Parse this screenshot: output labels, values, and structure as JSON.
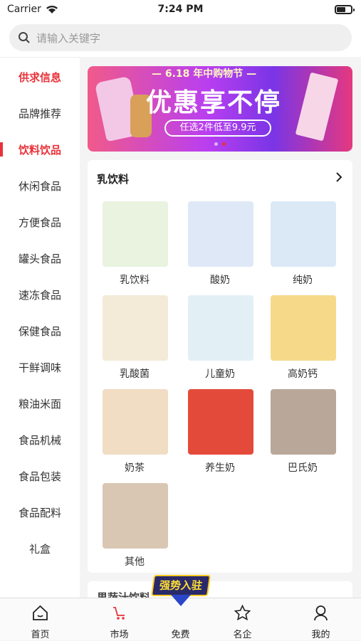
{
  "status": {
    "carrier": "Carrier",
    "time": "7:24 PM"
  },
  "search": {
    "placeholder": "请输入关键字"
  },
  "sidebar": {
    "items": [
      {
        "label": "供求信息"
      },
      {
        "label": "品牌推荐"
      },
      {
        "label": "饮料饮品"
      },
      {
        "label": "休闲食品"
      },
      {
        "label": "方便食品"
      },
      {
        "label": "罐头食品"
      },
      {
        "label": "速冻食品"
      },
      {
        "label": "保健食品"
      },
      {
        "label": "干鲜调味"
      },
      {
        "label": "粮油米面"
      },
      {
        "label": "食品机械"
      },
      {
        "label": "食品包装"
      },
      {
        "label": "食品配料"
      },
      {
        "label": "礼盒"
      }
    ]
  },
  "banner": {
    "top_line": "— 6.18 年中购物节 —",
    "main": "优惠享不停",
    "pill": "任选2件低至9.9元"
  },
  "section": {
    "title": "乳饮料",
    "items": [
      {
        "label": "乳饮料",
        "color": "#e9f3df"
      },
      {
        "label": "酸奶",
        "color": "#dfe8f6"
      },
      {
        "label": "纯奶",
        "color": "#dbe9f7"
      },
      {
        "label": "乳酸菌",
        "color": "#f3ead8"
      },
      {
        "label": "儿童奶",
        "color": "#e2f0f6"
      },
      {
        "label": "高奶钙",
        "color": "#f7d98a"
      },
      {
        "label": "奶茶",
        "color": "#f1dcc4"
      },
      {
        "label": "养生奶",
        "color": "#e44a3a"
      },
      {
        "label": "巴氏奶",
        "color": "#b9a89a"
      },
      {
        "label": "其他",
        "color": "#d9c7b4"
      }
    ]
  },
  "section2": {
    "title": "果蔬汁饮料"
  },
  "promo": {
    "label": "强势入驻"
  },
  "tabs": [
    {
      "label": "首页"
    },
    {
      "label": "市场"
    },
    {
      "label": "免费"
    },
    {
      "label": "名企"
    },
    {
      "label": "我的"
    }
  ],
  "colors": {
    "accent": "#e8323a"
  }
}
